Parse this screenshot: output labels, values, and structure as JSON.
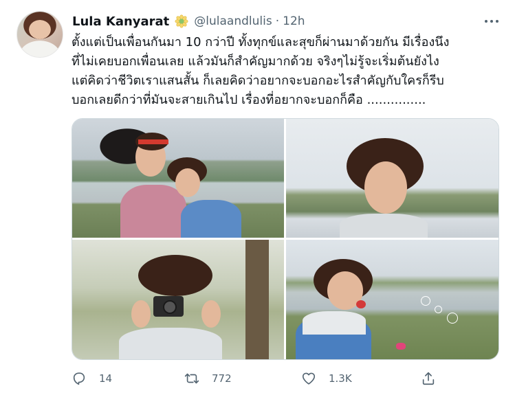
{
  "tweet": {
    "display_name": "Lula Kanyarat",
    "handle": "@lulaandlulis",
    "separator": "·",
    "time": "12h",
    "text": "ตั้งแต่เป็นเพื่อนกันมา 10 กว่าปี ทั้งทุกข์และสุขก็ผ่านมาด้วยกัน มีเรื่องนึง\nที่ไม่เคยบอกเพื่อนเลย แล้วมันก็สำคัญมากด้วย จริงๆไม่รู้จะเริ่มต้นยังไง\nแต่คิดว่าชีวิตเราแสนสั้น ก็เลยคิดว่าอยากจะบอกอะไรสำคัญกับใครก็รีบ\nบอกเลยดีกว่าที่มันจะสายเกินไป เรื่องที่อยากจะบอกก็คือ ..............."
  },
  "icons": {
    "badge": "sunflower-emoji-icon",
    "more": "more-options-icon",
    "reply": "reply-icon",
    "retweet": "retweet-icon",
    "like": "like-icon",
    "share": "share-icon"
  },
  "actions": {
    "reply_count": "14",
    "retweet_count": "772",
    "like_count": "1.3K"
  },
  "colors": {
    "text": "#0f1419",
    "secondary": "#536471",
    "border": "#cfd9de"
  }
}
